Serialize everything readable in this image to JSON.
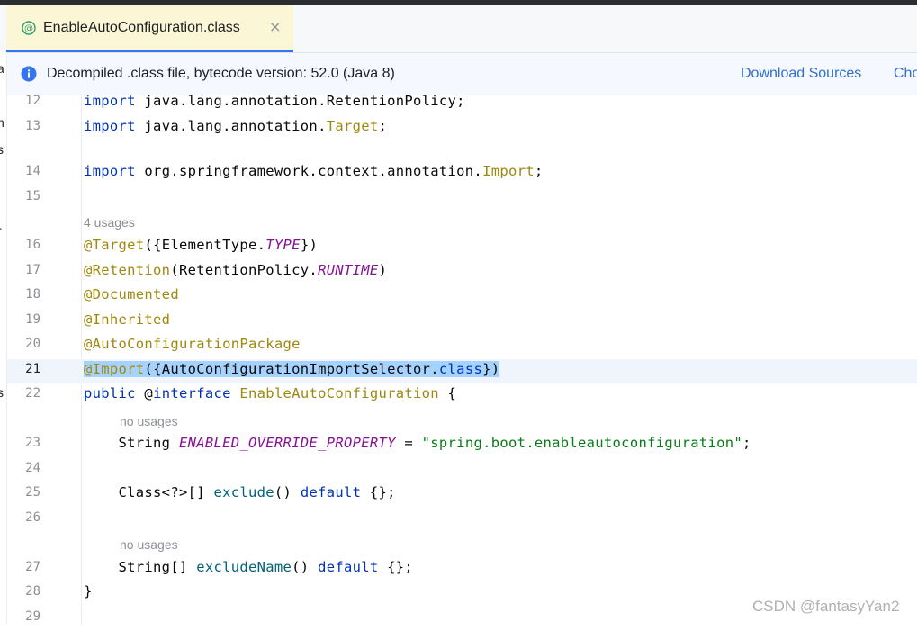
{
  "tab": {
    "icon": "annotation-class-icon",
    "label": "EnableAutoConfiguration.class",
    "close_glyph": "×"
  },
  "banner": {
    "icon": "info-icon",
    "text": "Decompiled .class file, bytecode version: 52.0 (Java 8)",
    "download_sources": "Download Sources",
    "choose_sources": "Cho"
  },
  "left_strip": [
    "a",
    "n",
    "s",
    "r",
    "s"
  ],
  "editor": {
    "caret_line": "21",
    "lines": [
      {
        "num": "12",
        "tokens": [
          [
            "kw",
            "import"
          ],
          [
            "p",
            " java.lang.annotation.RetentionPolicy;"
          ]
        ]
      },
      {
        "num": "13",
        "tokens": [
          [
            "kw",
            "import"
          ],
          [
            "p",
            " java.lang.annotation."
          ],
          [
            "ann",
            "Target"
          ],
          [
            "p",
            ";"
          ]
        ]
      },
      {
        "num": "14",
        "tokens": [
          [
            "kw",
            "import"
          ],
          [
            "p",
            " org.springframework.context.annotation."
          ],
          [
            "ann",
            "Import"
          ],
          [
            "p",
            ";"
          ]
        ]
      },
      {
        "num": "15",
        "tokens": []
      },
      {
        "num": "16",
        "tokens": [
          [
            "ann",
            "@Target"
          ],
          [
            "p",
            "({ElementType."
          ],
          [
            "constf",
            "TYPE"
          ],
          [
            "p",
            "})"
          ]
        ]
      },
      {
        "num": "17",
        "tokens": [
          [
            "ann",
            "@Retention"
          ],
          [
            "p",
            "(RetentionPolicy."
          ],
          [
            "constf",
            "RUNTIME"
          ],
          [
            "p",
            ")"
          ]
        ]
      },
      {
        "num": "18",
        "tokens": [
          [
            "ann",
            "@Documented"
          ]
        ]
      },
      {
        "num": "19",
        "tokens": [
          [
            "ann",
            "@Inherited"
          ]
        ]
      },
      {
        "num": "20",
        "tokens": [
          [
            "ann",
            "@AutoConfigurationPackage"
          ]
        ]
      },
      {
        "num": "21",
        "tokens": [
          [
            "ann",
            "@Import"
          ],
          [
            "p",
            "({AutoConfigurationImportSelector."
          ],
          [
            "kw",
            "class"
          ],
          [
            "p",
            "})"
          ]
        ]
      },
      {
        "num": "22",
        "tokens": [
          [
            "kw",
            "public"
          ],
          [
            "p",
            " @"
          ],
          [
            "kw",
            "interface"
          ],
          [
            "p",
            " "
          ],
          [
            "ifc",
            "EnableAutoConfiguration"
          ],
          [
            "p",
            " {"
          ]
        ]
      },
      {
        "num": "23",
        "tokens": [
          [
            "p",
            "    String "
          ],
          [
            "constf",
            "ENABLED_OVERRIDE_PROPERTY"
          ],
          [
            "p",
            " = "
          ],
          [
            "str",
            "\"spring.boot.enableautoconfiguration\""
          ],
          [
            "p",
            ";"
          ]
        ]
      },
      {
        "num": "24",
        "tokens": []
      },
      {
        "num": "25",
        "tokens": [
          [
            "p",
            "    Class<?>[] "
          ],
          [
            "meth",
            "exclude"
          ],
          [
            "p",
            "() "
          ],
          [
            "kw",
            "default"
          ],
          [
            "p",
            " {};"
          ]
        ]
      },
      {
        "num": "26",
        "tokens": []
      },
      {
        "num": "27",
        "tokens": [
          [
            "p",
            "    String[] "
          ],
          [
            "meth",
            "excludeName"
          ],
          [
            "p",
            "() "
          ],
          [
            "kw",
            "default"
          ],
          [
            "p",
            " {};"
          ]
        ]
      },
      {
        "num": "28",
        "tokens": [
          [
            "p",
            "}"
          ]
        ]
      },
      {
        "num": "29",
        "tokens": []
      }
    ],
    "hints": {
      "usages_16": "4 usages",
      "usages_23": "no usages",
      "usages_27": "no usages"
    }
  },
  "watermark": "CSDN @fantasyYan2",
  "colors": {
    "keyword": "#0033b3",
    "annotation": "#9e880d",
    "constant": "#871094",
    "string": "#067d17",
    "method": "#00627a",
    "selection": "#a6d2ff",
    "link": "#2f6fd1"
  }
}
